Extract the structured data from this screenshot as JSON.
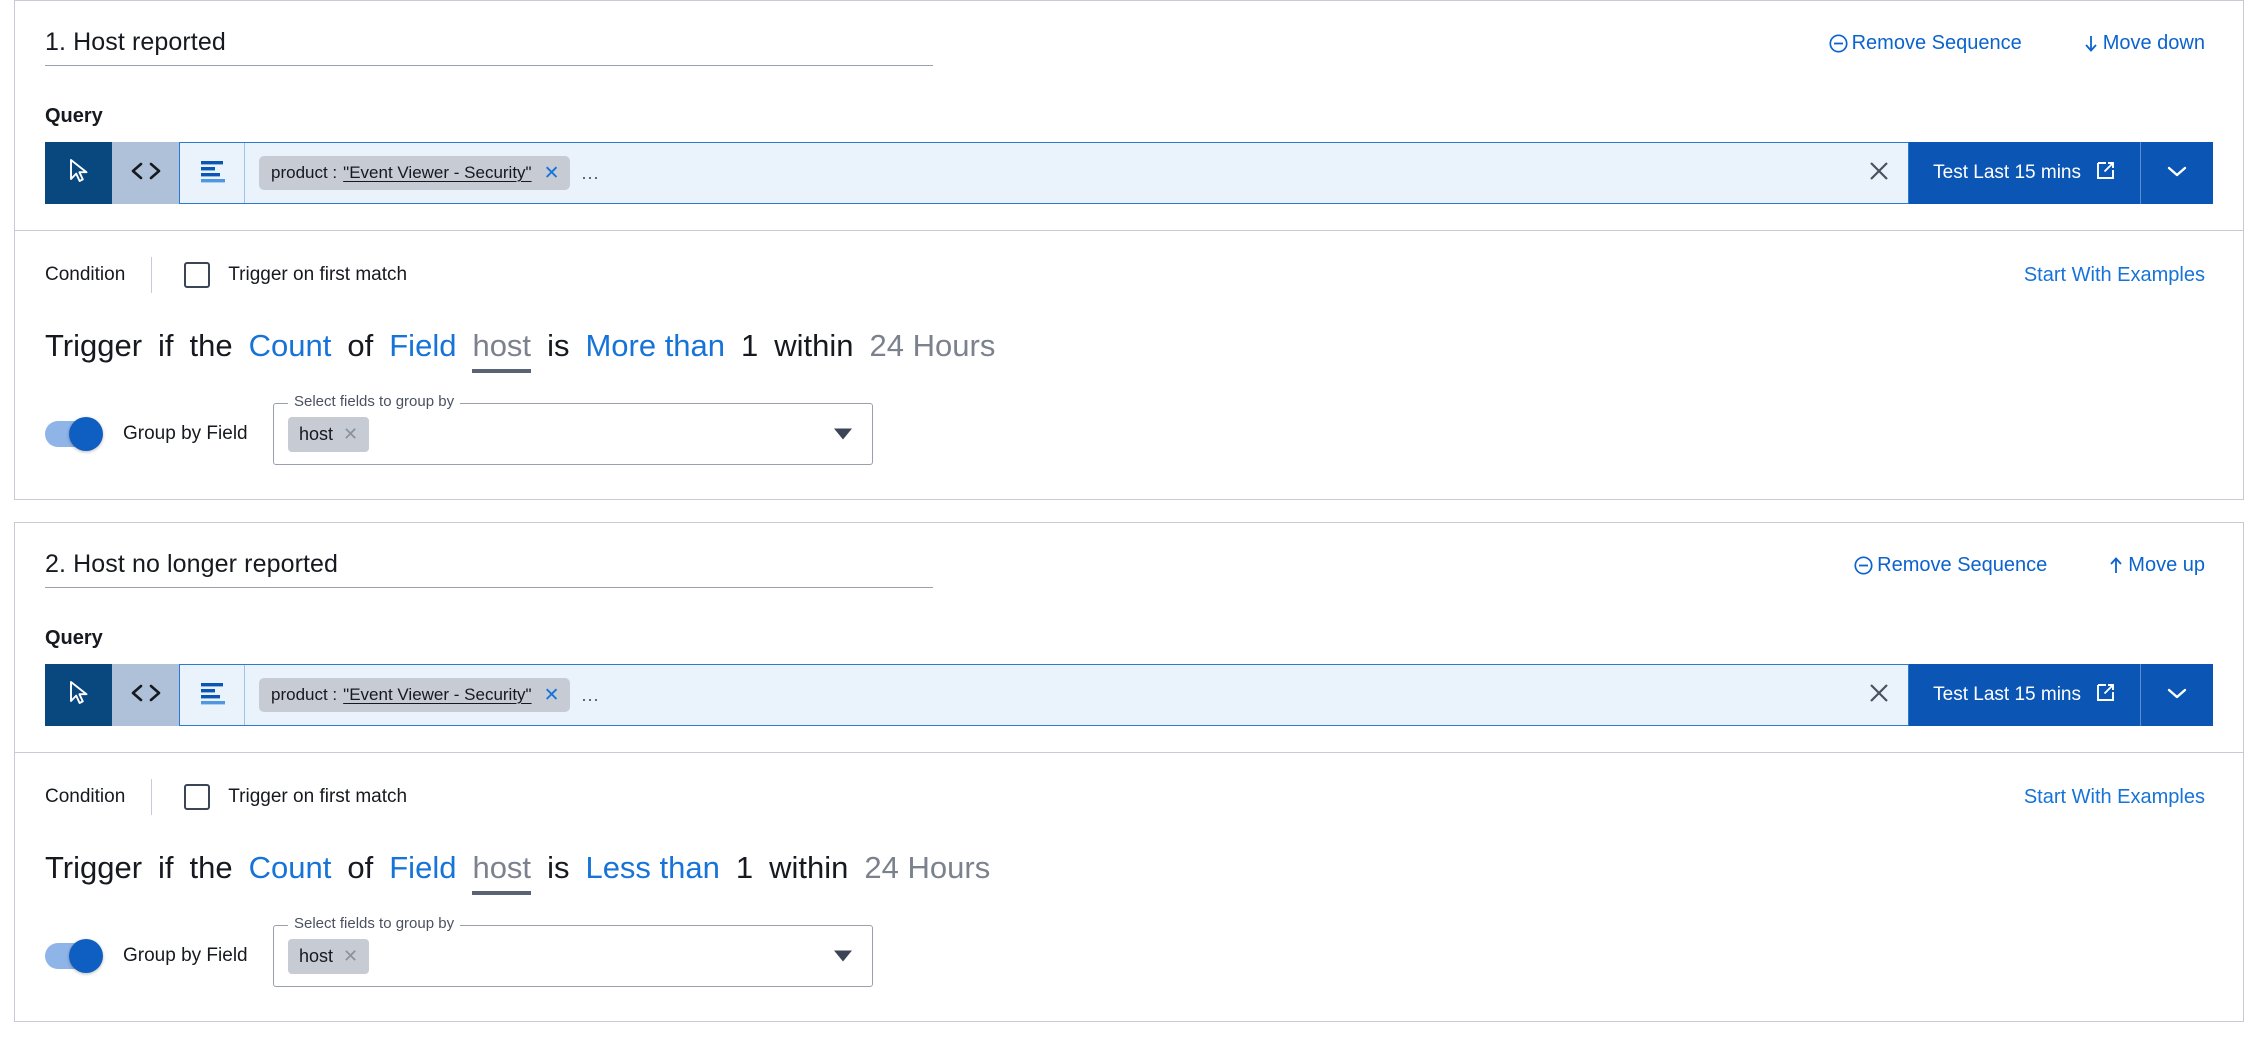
{
  "sequences": [
    {
      "title": "1. Host reported",
      "actions": {
        "remove_label": "Remove Sequence",
        "move_label": "Move down",
        "move_direction": "down",
        "remove_icon": "minus-circle-icon",
        "move_icon": "arrow-down-icon"
      },
      "query": {
        "label": "Query",
        "mode_cursor_icon": "cursor-arrow-icon",
        "mode_code_icon": "code-brackets-icon",
        "align_icon": "text-align-left-icon",
        "chip": {
          "key": "product :",
          "value": "\"Event Viewer - Security\"",
          "remove_icon": "close-x-icon"
        },
        "ellipsis": "...",
        "clear_icon": "close-x-icon",
        "test_label": "Test Last 15 mins",
        "test_icon": "external-link-icon",
        "caret_icon": "chevron-down-icon"
      },
      "condition": {
        "label": "Condition",
        "first_match_label": "Trigger on first match",
        "first_match_checked": false,
        "examples_link": "Start With Examples",
        "sentence": {
          "trigger": "Trigger",
          "if": "if",
          "the": "the",
          "aggregate": "Count",
          "of": "of",
          "field_word": "Field",
          "field_name": "host",
          "is": "is",
          "operator": "More than",
          "value": "1",
          "within": "within",
          "timeframe": "24 Hours"
        },
        "groupby": {
          "toggle_on": true,
          "label": "Group by Field",
          "field_legend": "Select fields to group by",
          "chips": [
            "host"
          ],
          "chip_remove_icon": "close-x-icon",
          "caret_icon": "caret-down-icon"
        }
      }
    },
    {
      "title": "2. Host no longer reported",
      "actions": {
        "remove_label": "Remove Sequence",
        "move_label": "Move up",
        "move_direction": "up",
        "remove_icon": "minus-circle-icon",
        "move_icon": "arrow-up-icon"
      },
      "query": {
        "label": "Query",
        "mode_cursor_icon": "cursor-arrow-icon",
        "mode_code_icon": "code-brackets-icon",
        "align_icon": "text-align-left-icon",
        "chip": {
          "key": "product :",
          "value": "\"Event Viewer - Security\"",
          "remove_icon": "close-x-icon"
        },
        "ellipsis": "...",
        "clear_icon": "close-x-icon",
        "test_label": "Test Last 15 mins",
        "test_icon": "external-link-icon",
        "caret_icon": "chevron-down-icon"
      },
      "condition": {
        "label": "Condition",
        "first_match_label": "Trigger on first match",
        "first_match_checked": false,
        "examples_link": "Start With Examples",
        "sentence": {
          "trigger": "Trigger",
          "if": "if",
          "the": "the",
          "aggregate": "Count",
          "of": "of",
          "field_word": "Field",
          "field_name": "host",
          "is": "is",
          "operator": "Less than",
          "value": "1",
          "within": "within",
          "timeframe": "24 Hours"
        },
        "groupby": {
          "toggle_on": true,
          "label": "Group by Field",
          "field_legend": "Select fields to group by",
          "chips": [
            "host"
          ],
          "chip_remove_icon": "close-x-icon",
          "caret_icon": "caret-down-icon"
        }
      }
    }
  ],
  "colors": {
    "link_blue": "#1673d8",
    "action_blue": "#0b63ce",
    "primary_button": "#0b55b5",
    "mode_active": "#09477f",
    "mode_inactive": "#afc1d8",
    "query_bg": "#eaf3fc",
    "query_border": "#2a7ad4",
    "chip_bg": "#c6cbd4",
    "card_border": "#c6cbd4",
    "muted_text": "#7b818d",
    "toggle_track": "#8fb4e8",
    "toggle_knob": "#0f5fc2"
  }
}
